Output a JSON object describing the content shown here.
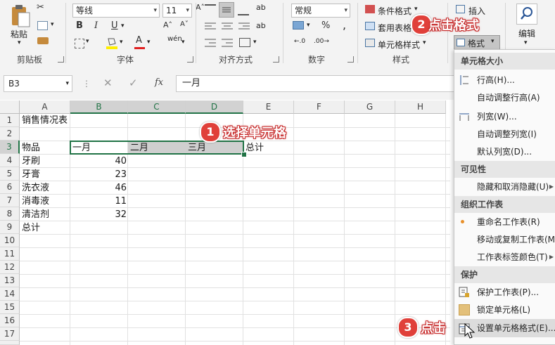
{
  "ribbon": {
    "clipboard": {
      "paste_label": "粘贴",
      "group_label": "剪贴板"
    },
    "font": {
      "font_name": "等线",
      "font_size": "11",
      "bold": "B",
      "italic": "I",
      "underline": "U",
      "border_arrow": "▾",
      "font_color_letter": "A",
      "phonetic": "wén",
      "group_label": "字体"
    },
    "alignment": {
      "wrap_glyph": "ab",
      "group_label": "对齐方式"
    },
    "number": {
      "format_value": "常规",
      "percent": "%",
      "comma": ",",
      "group_label": "数字"
    },
    "styles": {
      "conditional": "条件格式",
      "table_format": "套用表格格式",
      "cell_styles": "单元格样式",
      "group_label": "样式"
    },
    "cells": {
      "insert": "插入",
      "format": "格式"
    },
    "editing": {
      "label": "编辑"
    }
  },
  "formula_bar": {
    "name_box": "B3",
    "fx": "fx",
    "formula": "一月"
  },
  "columns": [
    "A",
    "B",
    "C",
    "D",
    "E",
    "F",
    "G",
    "H"
  ],
  "rows": [
    "1",
    "2",
    "3",
    "4",
    "5",
    "6",
    "7",
    "8",
    "9",
    "10",
    "11",
    "12",
    "13",
    "14",
    "15",
    "16",
    "17"
  ],
  "cells": {
    "A1": "销售情况表",
    "A3": "物品",
    "B3": "一月",
    "C3": "二月",
    "D3": "三月",
    "E3": "总计",
    "A4": "牙刷",
    "B4": "40",
    "A5": "牙膏",
    "B5": "23",
    "A6": "洗衣液",
    "B6": "46",
    "A7": "消毒液",
    "B7": "11",
    "A8": "清洁剂",
    "B8": "32",
    "A9": "总计"
  },
  "callouts": {
    "step1": {
      "num": "1",
      "text": "选择单元格"
    },
    "step2": {
      "num": "2",
      "text": "点击格式"
    },
    "step3": {
      "num": "3",
      "text": "点击"
    }
  },
  "menu": {
    "h_cell_size": "单元格大小",
    "row_height": "行高(H)...",
    "autofit_row": "自动调整行高(A)",
    "col_width": "列宽(W)...",
    "autofit_col": "自动调整列宽(I)",
    "default_width": "默认列宽(D)...",
    "h_visibility": "可见性",
    "hide_unhide": "隐藏和取消隐藏(U)",
    "h_organize": "组织工作表",
    "rename": "重命名工作表(R)",
    "move_copy": "移动或复制工作表(M)...",
    "tab_color": "工作表标签颜色(T)",
    "h_protect": "保护",
    "protect_sheet": "保护工作表(P)...",
    "lock_cell": "锁定单元格(L)",
    "format_cells": "设置单元格格式(E)..."
  },
  "colors": {
    "accent": "#217346",
    "callout": "#e0403a",
    "font_red": "#e02020",
    "highlight_yellow": "#ffee00"
  }
}
